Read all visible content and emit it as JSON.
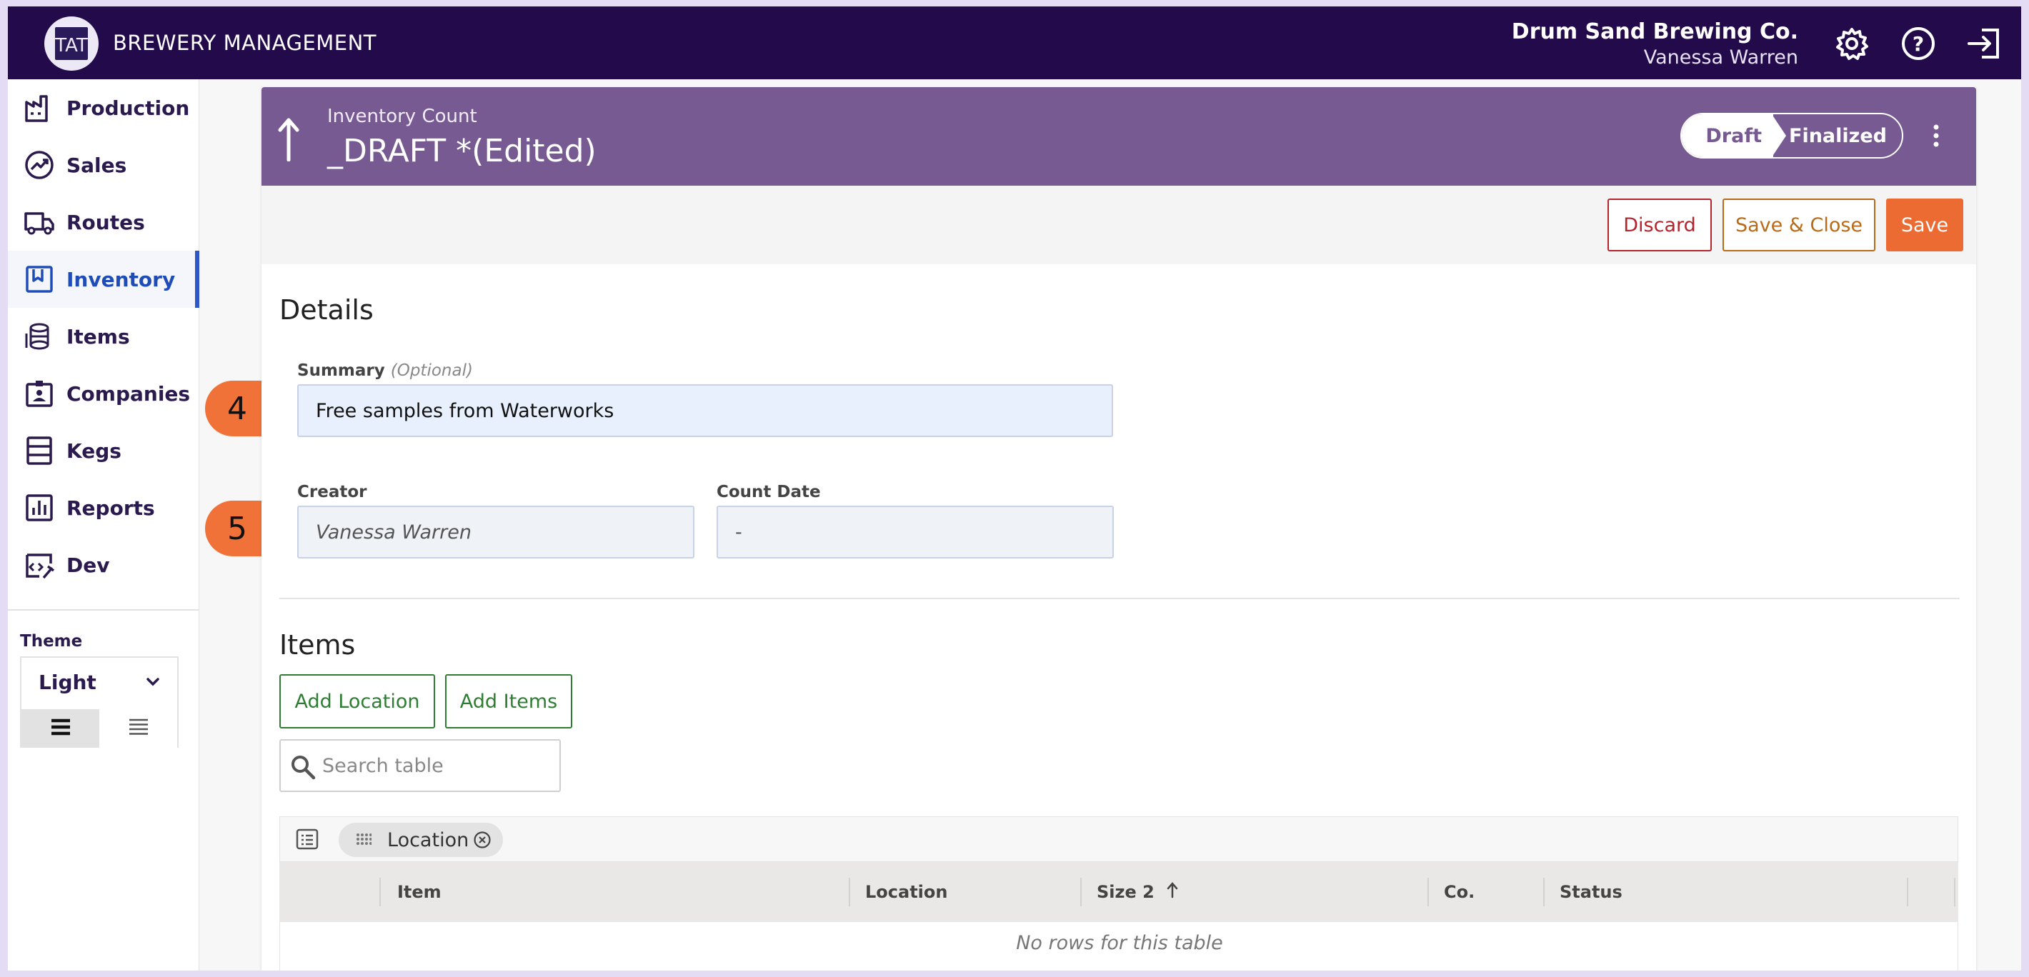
{
  "app": {
    "title": "BREWERY MANAGEMENT",
    "logo": "brewery-logo"
  },
  "header": {
    "company": "Drum Sand Brewing Co.",
    "user": "Vanessa Warren",
    "icons": [
      "gear-icon",
      "help-icon",
      "logout-icon"
    ]
  },
  "sidebar": {
    "items": [
      {
        "label": "Production",
        "icon": "factory-icon"
      },
      {
        "label": "Sales",
        "icon": "trend-icon"
      },
      {
        "label": "Routes",
        "icon": "truck-icon"
      },
      {
        "label": "Inventory",
        "icon": "inventory-icon",
        "active": true
      },
      {
        "label": "Items",
        "icon": "barrels-icon"
      },
      {
        "label": "Companies",
        "icon": "badge-icon"
      },
      {
        "label": "Kegs",
        "icon": "keg-icon"
      },
      {
        "label": "Reports",
        "icon": "chart-icon"
      },
      {
        "label": "Dev",
        "icon": "code-icon"
      }
    ],
    "theme_label": "Theme",
    "theme_value": "Light"
  },
  "record": {
    "kicker": "Inventory Count",
    "title": "_DRAFT *(Edited)",
    "status_draft": "Draft",
    "status_finalized": "Finalized",
    "current_status": "Draft"
  },
  "actions": {
    "discard": "Discard",
    "save_close": "Save & Close",
    "save": "Save"
  },
  "details": {
    "title": "Details",
    "summary_label": "Summary",
    "summary_optional": "(Optional)",
    "summary_value": "Free samples from Waterworks",
    "creator_label": "Creator",
    "creator_value": "Vanessa Warren",
    "count_date_label": "Count Date",
    "count_date_value": "-"
  },
  "items_section": {
    "title": "Items",
    "add_location": "Add Location",
    "add_items": "Add Items",
    "search_placeholder": "Search table",
    "group_chip": "Location",
    "columns": [
      "Item",
      "Location",
      "Size 2",
      "Co.",
      "Status"
    ],
    "sorted_column": "Size 2",
    "sort_direction": "ascending",
    "empty_message": "No rows for this table"
  },
  "annotations": [
    "4",
    "5"
  ],
  "colors": {
    "topbar": "#230a4a",
    "card_header": "#765a91",
    "accent_orange": "#ec6b32",
    "active_nav": "#1f4db8",
    "callout": "#f07238"
  }
}
